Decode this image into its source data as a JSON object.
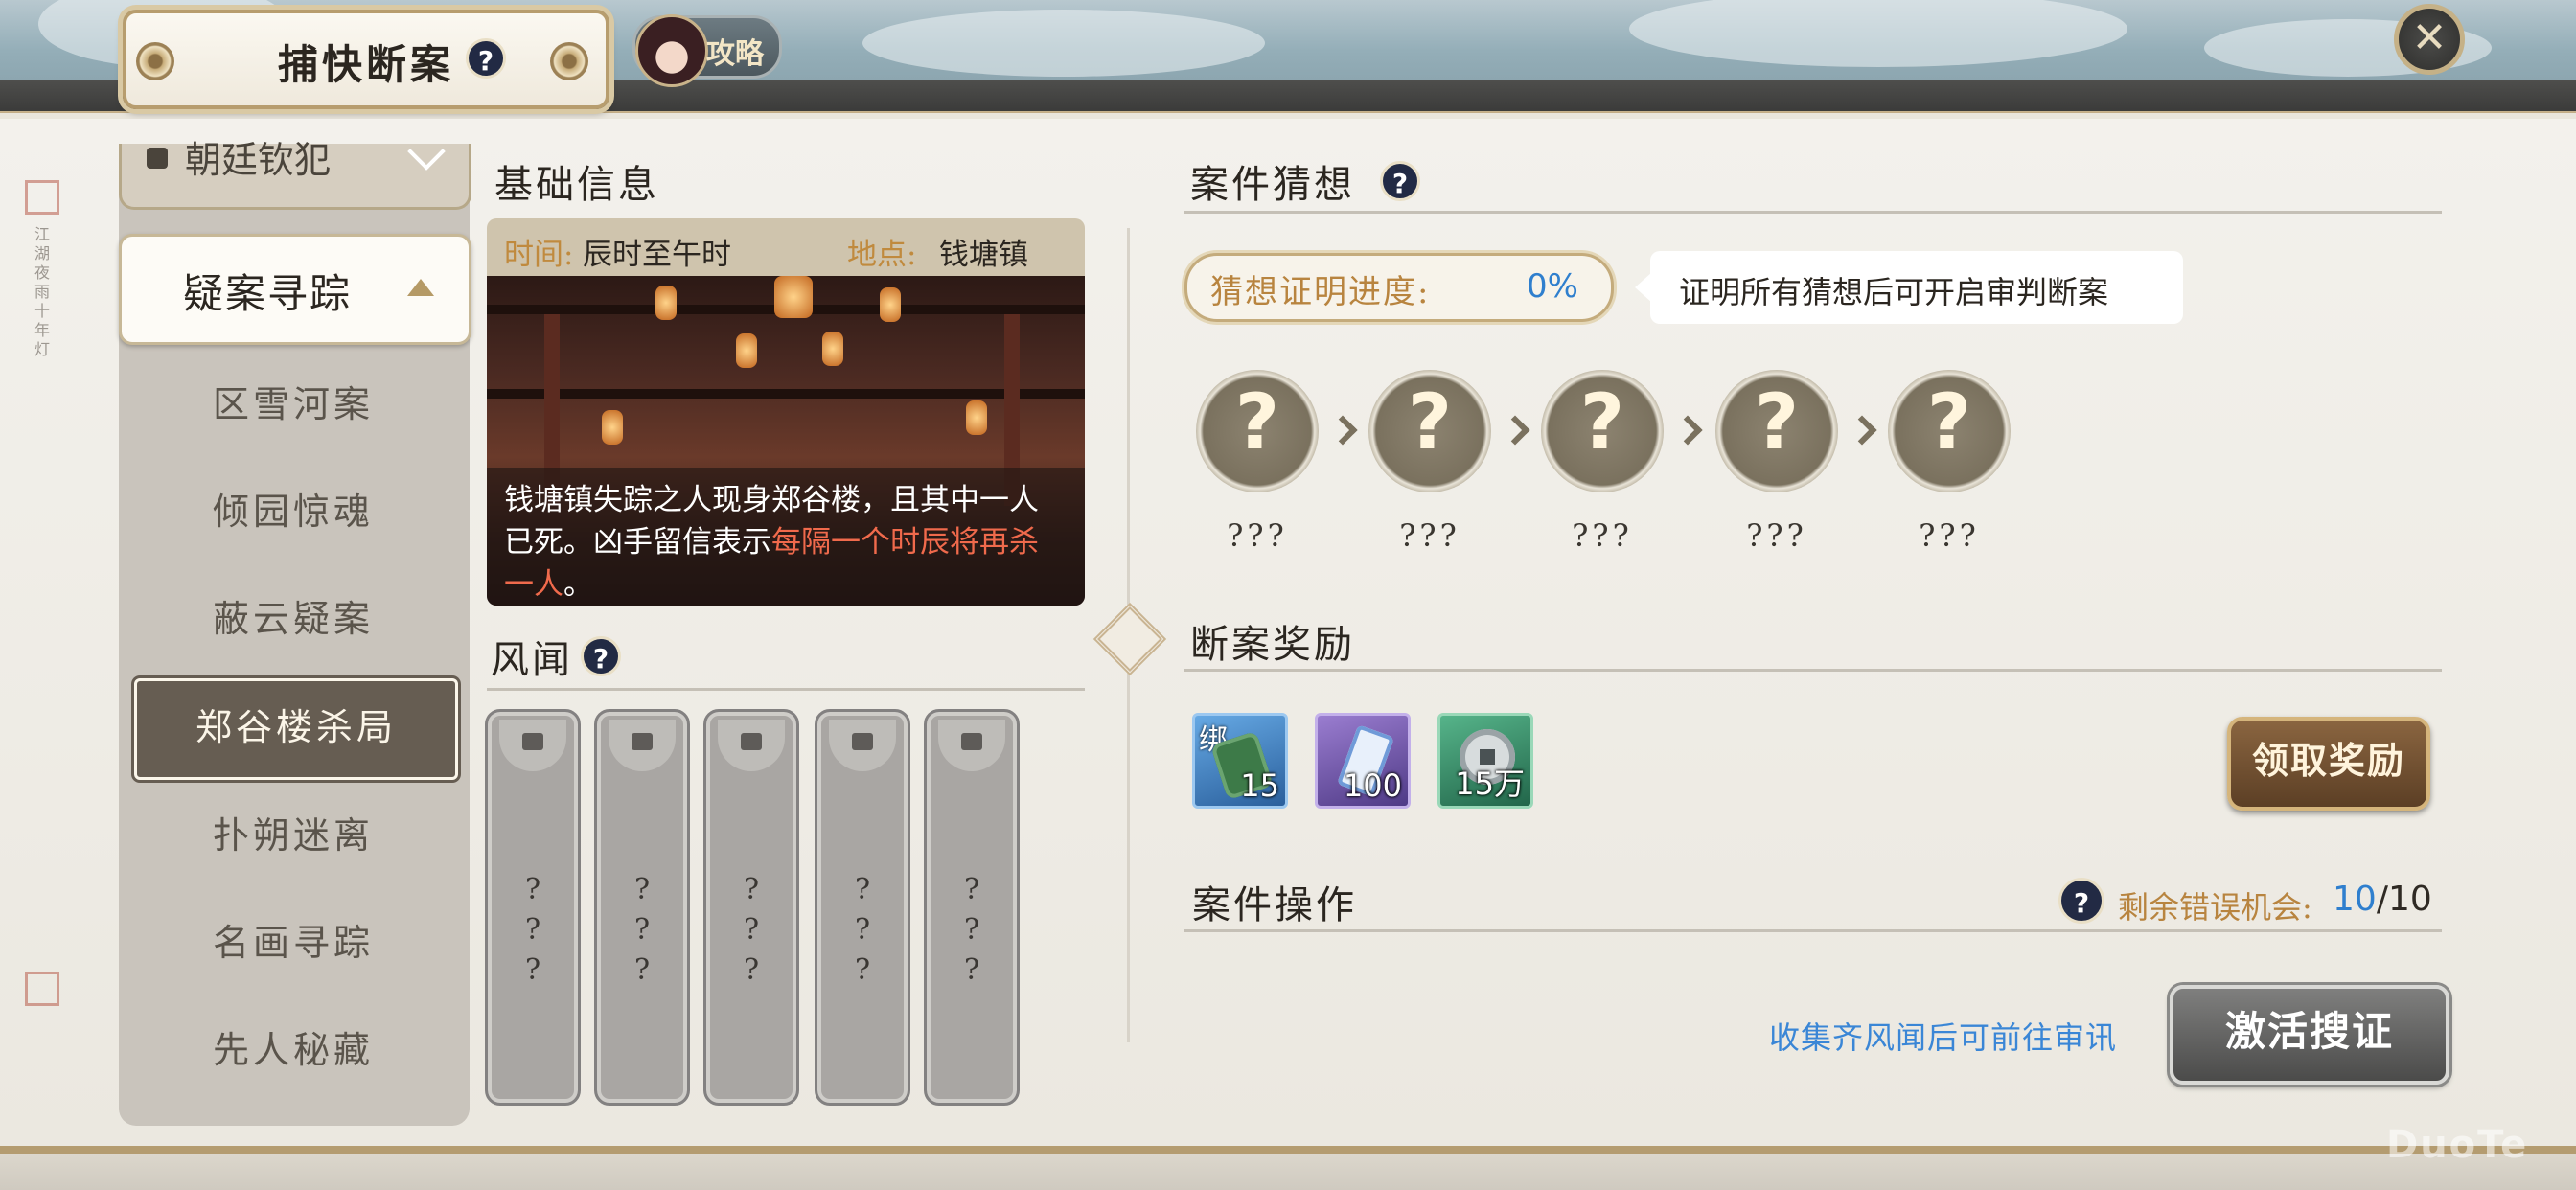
{
  "header": {
    "title": "捕快断案",
    "guide_label": "攻略",
    "close_symbol": "✕",
    "help_symbol": "?"
  },
  "sidebar": {
    "locked_category": "朝廷钦犯",
    "open_category": "疑案寻踪",
    "items": [
      {
        "label": "区雪河案",
        "selected": false
      },
      {
        "label": "倾园惊魂",
        "selected": false
      },
      {
        "label": "蔽云疑案",
        "selected": false
      },
      {
        "label": "郑谷楼杀局",
        "selected": true
      },
      {
        "label": "扑朔迷离",
        "selected": false
      },
      {
        "label": "名画寻踪",
        "selected": false
      },
      {
        "label": "先人秘藏",
        "selected": false
      }
    ]
  },
  "basic_info": {
    "title": "基础信息",
    "time_label": "时间:",
    "time_value": "辰时至午时",
    "place_label": "地点:",
    "place_value": "钱塘镇",
    "description_plain": "钱塘镇失踪之人现身郑谷楼，且其中一人已死。凶手留信表示",
    "description_highlight": "每隔一个时辰将再杀一人",
    "description_end": "。"
  },
  "rumors": {
    "title": "风闻",
    "cards": [
      {
        "lines": [
          "?",
          "?",
          "?"
        ],
        "locked": true
      },
      {
        "lines": [
          "?",
          "?",
          "?"
        ],
        "locked": true
      },
      {
        "lines": [
          "?",
          "?",
          "?"
        ],
        "locked": true
      },
      {
        "lines": [
          "?",
          "?",
          "?"
        ],
        "locked": true
      },
      {
        "lines": [
          "?",
          "?",
          "?"
        ],
        "locked": true
      }
    ]
  },
  "case_guess": {
    "title": "案件猜想",
    "progress_label": "猜想证明进度:",
    "progress_value": "0%",
    "progress_fraction": 0,
    "hint": "证明所有猜想后可开启审判断案",
    "guesses": [
      {
        "symbol": "?",
        "label": "???"
      },
      {
        "symbol": "?",
        "label": "???"
      },
      {
        "symbol": "?",
        "label": "???"
      },
      {
        "symbol": "?",
        "label": "???"
      },
      {
        "symbol": "?",
        "label": "???"
      }
    ]
  },
  "rewards": {
    "title": "断案奖励",
    "items": [
      {
        "icon": "jade-token-icon",
        "count": "15",
        "bound_label": "绑",
        "color": "#3a78c4"
      },
      {
        "icon": "scroll-icon",
        "count": "100",
        "bound_label": "",
        "color": "#6a4fa8"
      },
      {
        "icon": "coin-icon",
        "count": "15万",
        "bound_label": "",
        "color": "#2f8a5a"
      }
    ],
    "claim_button": "领取奖励"
  },
  "operations": {
    "title": "案件操作",
    "chances_label": "剩余错误机会:",
    "chances_current": "10",
    "chances_total": "/10",
    "collect_hint": "收集齐风闻后可前往审讯",
    "activate_button": "激活搜证"
  },
  "watermark": "DuoTe"
}
